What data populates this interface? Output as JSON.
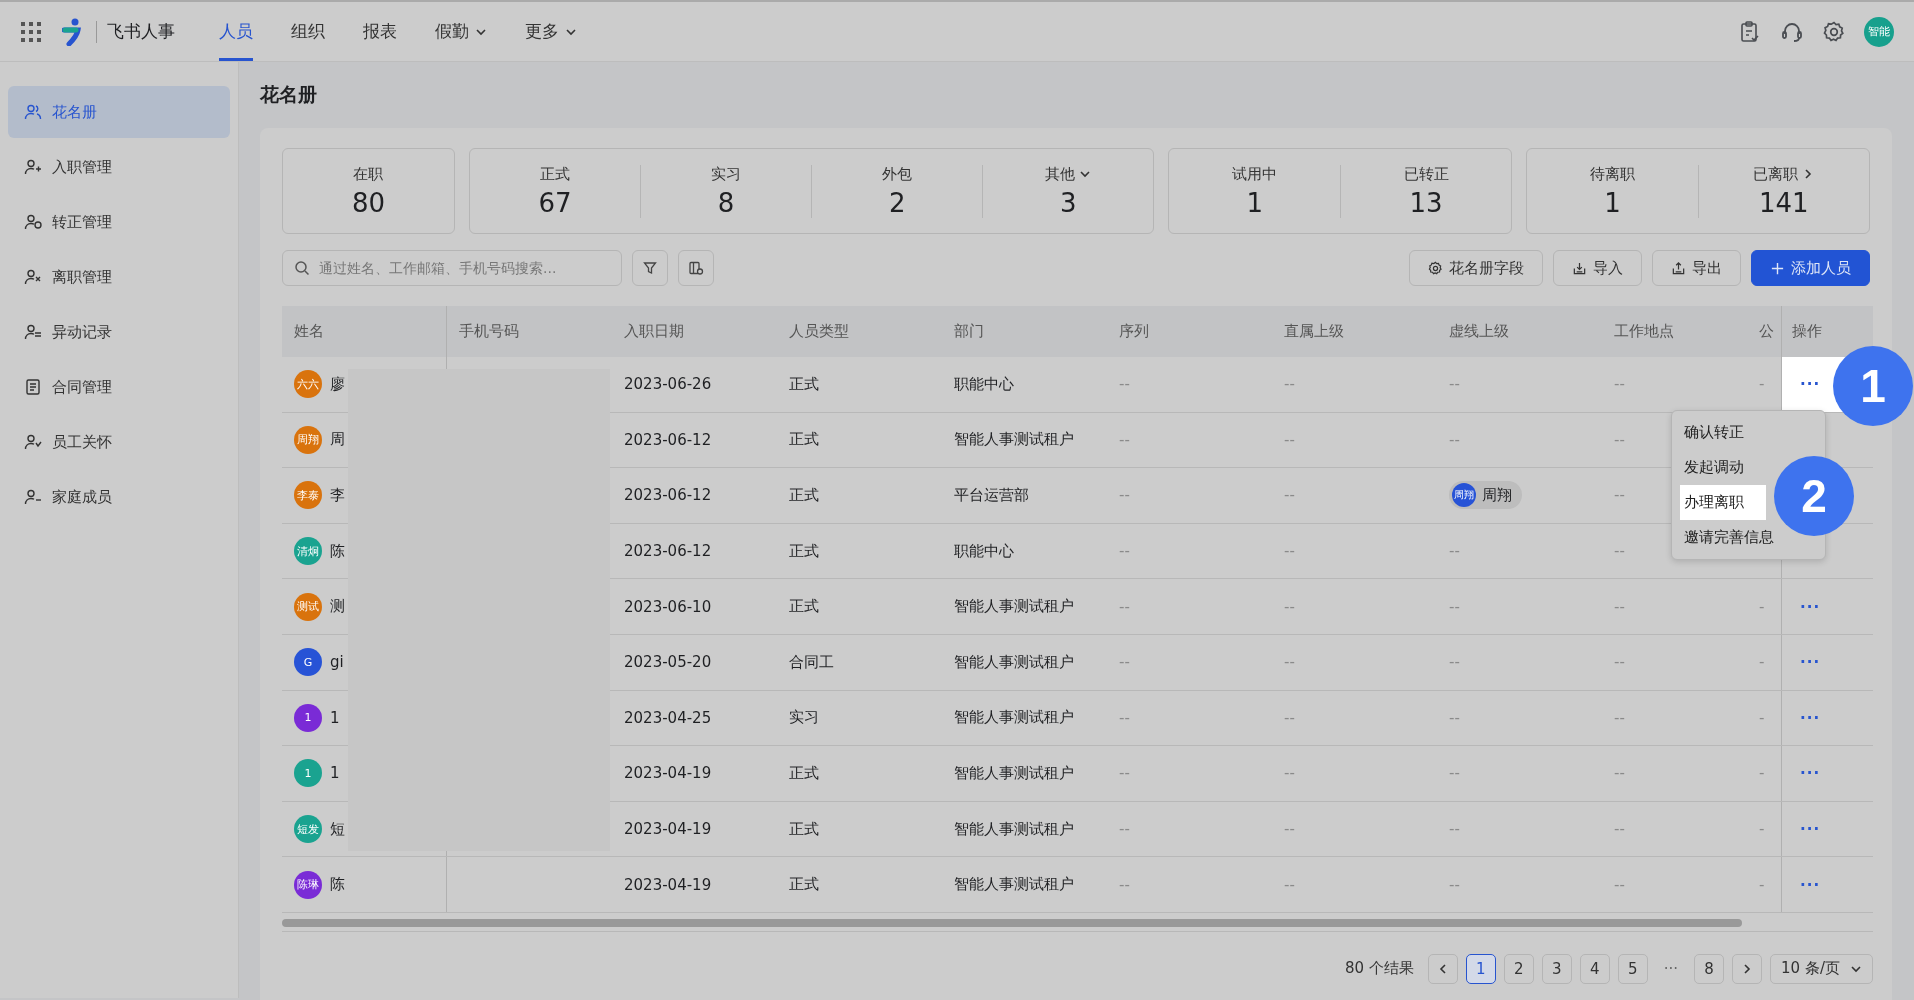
{
  "app": {
    "title": "飞书人事",
    "avatar_text": "智能"
  },
  "nav": [
    {
      "label": "人员",
      "selected": true,
      "dropdown": false
    },
    {
      "label": "组织",
      "selected": false,
      "dropdown": false
    },
    {
      "label": "报表",
      "selected": false,
      "dropdown": false
    },
    {
      "label": "假勤",
      "selected": false,
      "dropdown": true
    },
    {
      "label": "更多",
      "selected": false,
      "dropdown": true
    }
  ],
  "sidebar": {
    "items": [
      {
        "label": "花名册",
        "selected": true
      },
      {
        "label": "入职管理",
        "selected": false
      },
      {
        "label": "转正管理",
        "selected": false
      },
      {
        "label": "离职管理",
        "selected": false
      },
      {
        "label": "异动记录",
        "selected": false
      },
      {
        "label": "合同管理",
        "selected": false
      },
      {
        "label": "员工关怀",
        "selected": false
      },
      {
        "label": "家庭成员",
        "selected": false
      }
    ]
  },
  "page_title": "花名册",
  "stat_groups": [
    [
      {
        "label": "在职",
        "value": "80",
        "kind": "plain"
      }
    ],
    [
      {
        "label": "正式",
        "value": "67",
        "kind": "plain"
      },
      {
        "label": "实习",
        "value": "8",
        "kind": "plain"
      },
      {
        "label": "外包",
        "value": "2",
        "kind": "plain"
      },
      {
        "label": "其他",
        "value": "3",
        "kind": "dropdown"
      }
    ],
    [
      {
        "label": "试用中",
        "value": "1",
        "kind": "plain"
      },
      {
        "label": "已转正",
        "value": "13",
        "kind": "plain"
      }
    ],
    [
      {
        "label": "待离职",
        "value": "1",
        "kind": "plain"
      },
      {
        "label": "已离职",
        "value": "141",
        "kind": "link"
      }
    ]
  ],
  "search": {
    "placeholder": "通过姓名、工作邮箱、手机号码搜索..."
  },
  "buttons": [
    {
      "label": "花名册字段",
      "kind": "settings"
    },
    {
      "label": "导入",
      "kind": "import"
    },
    {
      "label": "导出",
      "kind": "export"
    },
    {
      "label": "添加人员",
      "kind": "add"
    }
  ],
  "table": {
    "columns": [
      "姓名",
      "手机号码",
      "入职日期",
      "人员类型",
      "部门",
      "序列",
      "直属上级",
      "虚线上级",
      "工作地点",
      "公",
      "操作"
    ],
    "rows": [
      {
        "cells": [
          {
            "avatar_text": "六六",
            "color": "#d9730d",
            "name": "廖"
          },
          "",
          "2023-06-26",
          "正式",
          "职能中心",
          "--",
          "--",
          "--",
          "--",
          "-",
          "···"
        ],
        "highlighted": true
      },
      {
        "cells": [
          {
            "avatar_text": "周翔",
            "color": "#d9730d",
            "name": "周"
          },
          "",
          "2023-06-12",
          "正式",
          "智能人事测试租户",
          "--",
          "--",
          "--",
          "--"
        ],
        "highlighted": false
      },
      {
        "cells": [
          {
            "avatar_text": "李泰",
            "color": "#d9730d",
            "name": "李"
          },
          "",
          "2023-06-12",
          "正式",
          "平台运营部",
          "--",
          "--",
          {
            "avatar_text": "周翔",
            "name": "周翔"
          },
          "--"
        ],
        "highlighted": false
      },
      {
        "cells": [
          {
            "avatar_text": "清炯",
            "color": "#1aa390",
            "name": "陈"
          },
          "",
          "2023-06-12",
          "正式",
          "职能中心",
          "--",
          "--",
          "--",
          "--"
        ],
        "highlighted": false
      },
      {
        "cells": [
          {
            "avatar_text": "测试",
            "color": "#d9730d",
            "name": "测"
          },
          "",
          "2023-06-10",
          "正式",
          "智能人事测试租户",
          "--",
          "--",
          "--",
          "--",
          "-",
          "···"
        ],
        "highlighted": false
      },
      {
        "cells": [
          {
            "avatar_text": "G",
            "color": "#2753d6",
            "name": "gi"
          },
          "",
          "2023-05-20",
          "合同工",
          "智能人事测试租户",
          "--",
          "--",
          "--",
          "--",
          "-",
          "···"
        ],
        "highlighted": false
      },
      {
        "cells": [
          {
            "avatar_text": "1",
            "color": "#7a2bd6",
            "name": "1"
          },
          "",
          "2023-04-25",
          "实习",
          "智能人事测试租户",
          "--",
          "--",
          "--",
          "--",
          "-",
          "···"
        ],
        "highlighted": false
      },
      {
        "cells": [
          {
            "avatar_text": "1",
            "color": "#1aa390",
            "name": "1"
          },
          "",
          "2023-04-19",
          "正式",
          "智能人事测试租户",
          "--",
          "--",
          "--",
          "--",
          "-",
          "···"
        ],
        "highlighted": false
      },
      {
        "cells": [
          {
            "avatar_text": "短发",
            "color": "#1aa390",
            "name": "短"
          },
          "",
          "2023-04-19",
          "正式",
          "智能人事测试租户",
          "--",
          "--",
          "--",
          "--",
          "-",
          "···"
        ],
        "highlighted": false
      },
      {
        "cells": [
          {
            "avatar_text": "陈琳",
            "color": "#7a2bd6",
            "name": "陈"
          },
          "",
          "2023-04-19",
          "正式",
          "智能人事测试租户",
          "--",
          "--",
          "--",
          "--",
          "-",
          "···"
        ],
        "highlighted": false
      }
    ]
  },
  "menu": {
    "items": [
      {
        "label": "确认转正",
        "highlighted": false
      },
      {
        "label": "发起调动",
        "highlighted": false
      },
      {
        "label": "办理离职",
        "highlighted": true
      },
      {
        "label": "邀请完善信息",
        "highlighted": false
      }
    ]
  },
  "guide_steps": [
    "1",
    "2"
  ],
  "pagination": {
    "total": "80 个结果",
    "pages": [
      {
        "label": "1",
        "selected": true
      },
      {
        "label": "2",
        "selected": false
      },
      {
        "label": "3",
        "selected": false
      },
      {
        "label": "4",
        "selected": false
      },
      {
        "label": "5",
        "selected": false
      },
      {
        "label": "···",
        "kind": "ellipsis",
        "selected": false
      },
      {
        "label": "8",
        "selected": false
      }
    ],
    "page_size": "10 条/页"
  }
}
